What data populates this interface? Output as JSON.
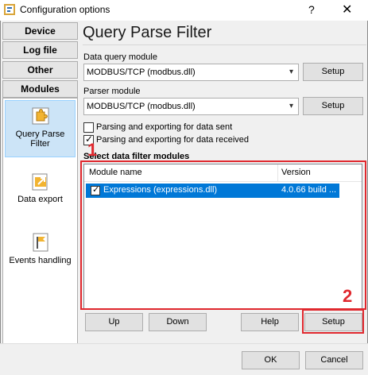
{
  "window": {
    "title": "Configuration options",
    "help_label": "?",
    "close_label": "✕"
  },
  "sidebar": {
    "categories": [
      "Device",
      "Log file",
      "Other",
      "Modules"
    ],
    "items": [
      {
        "label": "Query Parse Filter",
        "icon": "puzzle-icon"
      },
      {
        "label": "Data export",
        "icon": "export-icon"
      },
      {
        "label": "Events handling",
        "icon": "flag-icon"
      }
    ]
  },
  "main": {
    "title": "Query Parse Filter",
    "data_query_label": "Data query module",
    "data_query_value": "MODBUS/TCP (modbus.dll)",
    "parser_label": "Parser module",
    "parser_value": "MODBUS/TCP (modbus.dll)",
    "setup_label": "Setup",
    "check_sent_label": "Parsing and exporting for data sent",
    "check_received_label": "Parsing and exporting for data received",
    "section_label": "Select data filter modules",
    "list": {
      "columns": [
        "Module name",
        "Version"
      ],
      "rows": [
        {
          "name": "Expressions (expressions.dll)",
          "version": "4.0.66 build ..."
        }
      ]
    },
    "buttons": {
      "up": "Up",
      "down": "Down",
      "help": "Help",
      "setup": "Setup"
    },
    "annotations": [
      "1",
      "2"
    ]
  },
  "footer": {
    "ok": "OK",
    "cancel": "Cancel"
  },
  "colors": {
    "selection": "#0078d7",
    "highlight": "#e0282e"
  }
}
